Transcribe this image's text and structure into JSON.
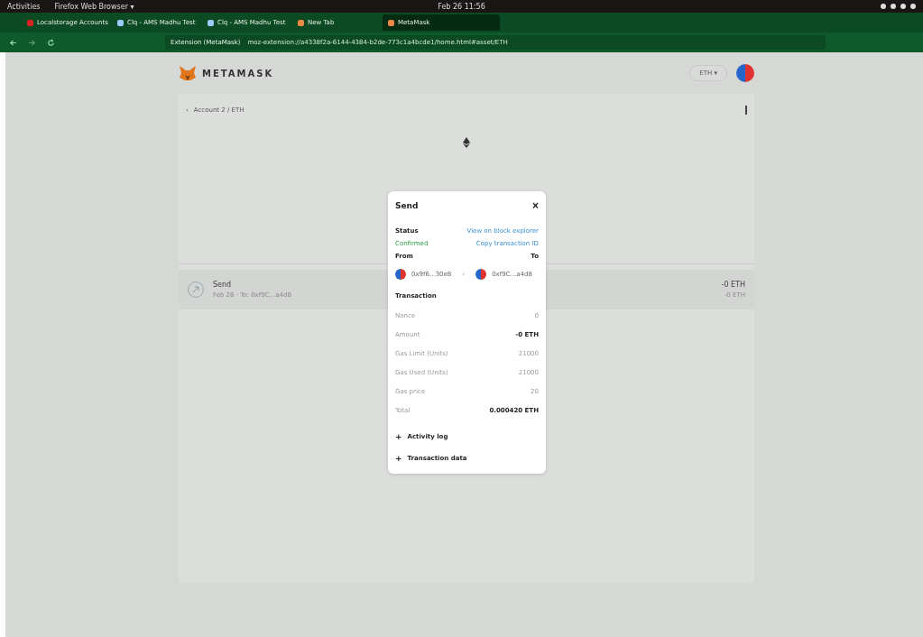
{
  "system_bar": {
    "activities": "Activities",
    "app_menu": "Firefox Web Browser ▾",
    "clock": "Feb 26 11:56"
  },
  "tabs": [
    {
      "label": "Localstorage Accounts",
      "selected": false
    },
    {
      "label": "Clq - AMS Madhu Test",
      "selected": false
    },
    {
      "label": "Clq - AMS Madhu Test",
      "selected": false
    },
    {
      "label": "New Tab",
      "selected": false
    },
    {
      "label": "MetaMask",
      "selected": true
    }
  ],
  "address_bar": {
    "identity": "Extension (MetaMask)",
    "url": "moz-extension://a4338f2a-6144-4384-b2de-773c1a4bcde1/home.html#asset/ETH"
  },
  "header": {
    "brand": "METAMASK",
    "network": "ETH ▾"
  },
  "breadcrumb": {
    "back": "‹",
    "text": "Account 2 / ETH"
  },
  "activity": [
    {
      "title": "Send",
      "subtitle": "Feb 26 · To: 0xf9C...a4d8",
      "amount": "-0 ETH",
      "fiat": "-0 ETH"
    }
  ],
  "modal": {
    "title": "Send",
    "close": "×",
    "status_label": "Status",
    "status": "Confirmed",
    "explorer_link": "View on block explorer",
    "copy_link": "Copy transaction ID",
    "from_label": "From",
    "to_label": "To",
    "from": "0x9f6...30e8",
    "arrow": "›",
    "to": "0xf9C...a4d8",
    "section": "Transaction",
    "rows": [
      {
        "label": "Nonce",
        "value": "0",
        "bold": false
      },
      {
        "label": "Amount",
        "value": "-0 ETH",
        "bold": true
      },
      {
        "label": "Gas Limit (Units)",
        "value": "21000",
        "bold": false
      },
      {
        "label": "Gas Used (Units)",
        "value": "21000",
        "bold": false
      },
      {
        "label": "Gas price",
        "value": "20",
        "bold": false
      },
      {
        "label": "Total",
        "value": "0.000420 ETH",
        "bold": true
      }
    ],
    "expanders": [
      {
        "icon": "+",
        "label": "Activity log"
      },
      {
        "icon": "+",
        "label": "Transaction data"
      }
    ]
  }
}
